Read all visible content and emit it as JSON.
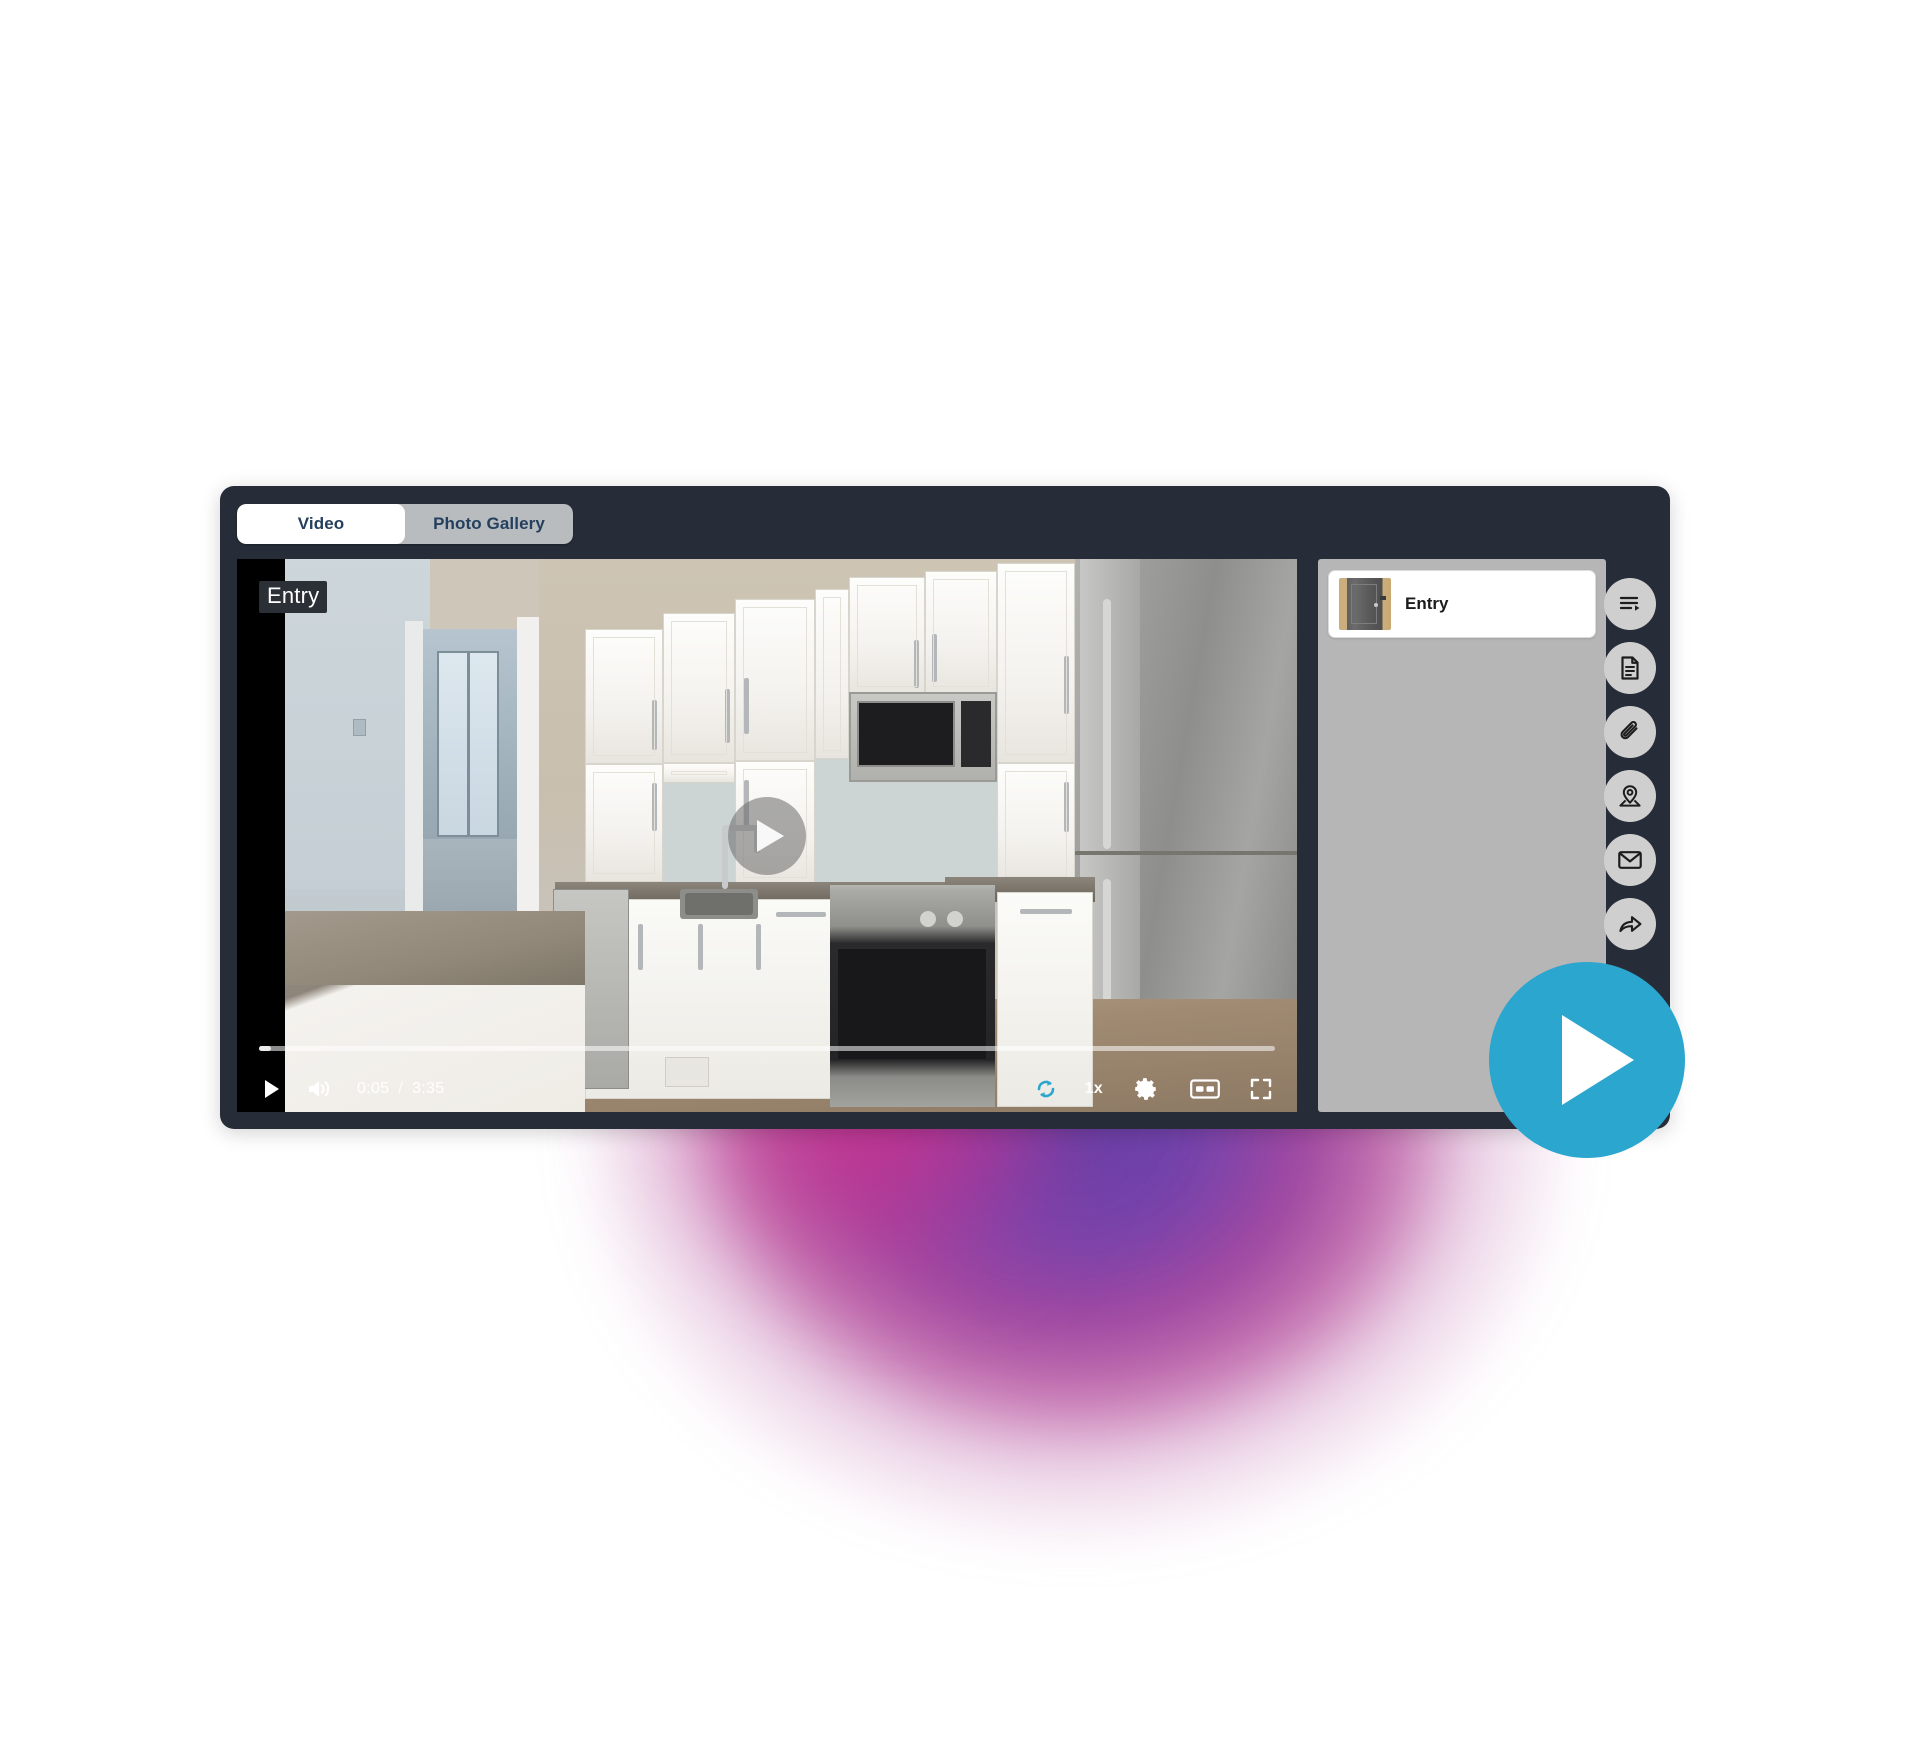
{
  "background": {
    "blob_top_color": "#ffa564",
    "blob_bottom_color_a": "#c0338f",
    "blob_bottom_color_b": "#5b3ba5"
  },
  "player": {
    "frame_color": "#262d38",
    "tabs": [
      {
        "label": "Video",
        "active": true
      },
      {
        "label": "Photo Gallery",
        "active": false
      }
    ],
    "video": {
      "overlay_label": "Entry",
      "center_play_icon": "play-icon",
      "scene_description": "Kitchen interior with white cabinets, stainless steel appliances"
    },
    "controls": {
      "play_icon": "play-icon",
      "volume_icon": "volume-icon",
      "current_time": "0:05",
      "time_separator": "/",
      "duration": "3:35",
      "progress_percent": 1.2,
      "loop_icon": "loop-icon",
      "loop_color": "#2ba6cf",
      "speed_label": "1x",
      "settings_icon": "gear-icon",
      "captions_icon": "cc-icon",
      "captions_label": "cc",
      "fullscreen_icon": "fullscreen-icon"
    },
    "chapters": {
      "panel_color": "#b6b6b6",
      "items": [
        {
          "label": "Entry",
          "thumbnail": "door-thumbnail"
        }
      ]
    },
    "rail": [
      {
        "name": "playlist-icon"
      },
      {
        "name": "document-icon"
      },
      {
        "name": "attachment-icon"
      },
      {
        "name": "location-pin-icon"
      },
      {
        "name": "email-icon"
      },
      {
        "name": "share-icon"
      }
    ]
  },
  "big_play_button": {
    "icon": "play-icon",
    "color": "#2ba6cf"
  }
}
